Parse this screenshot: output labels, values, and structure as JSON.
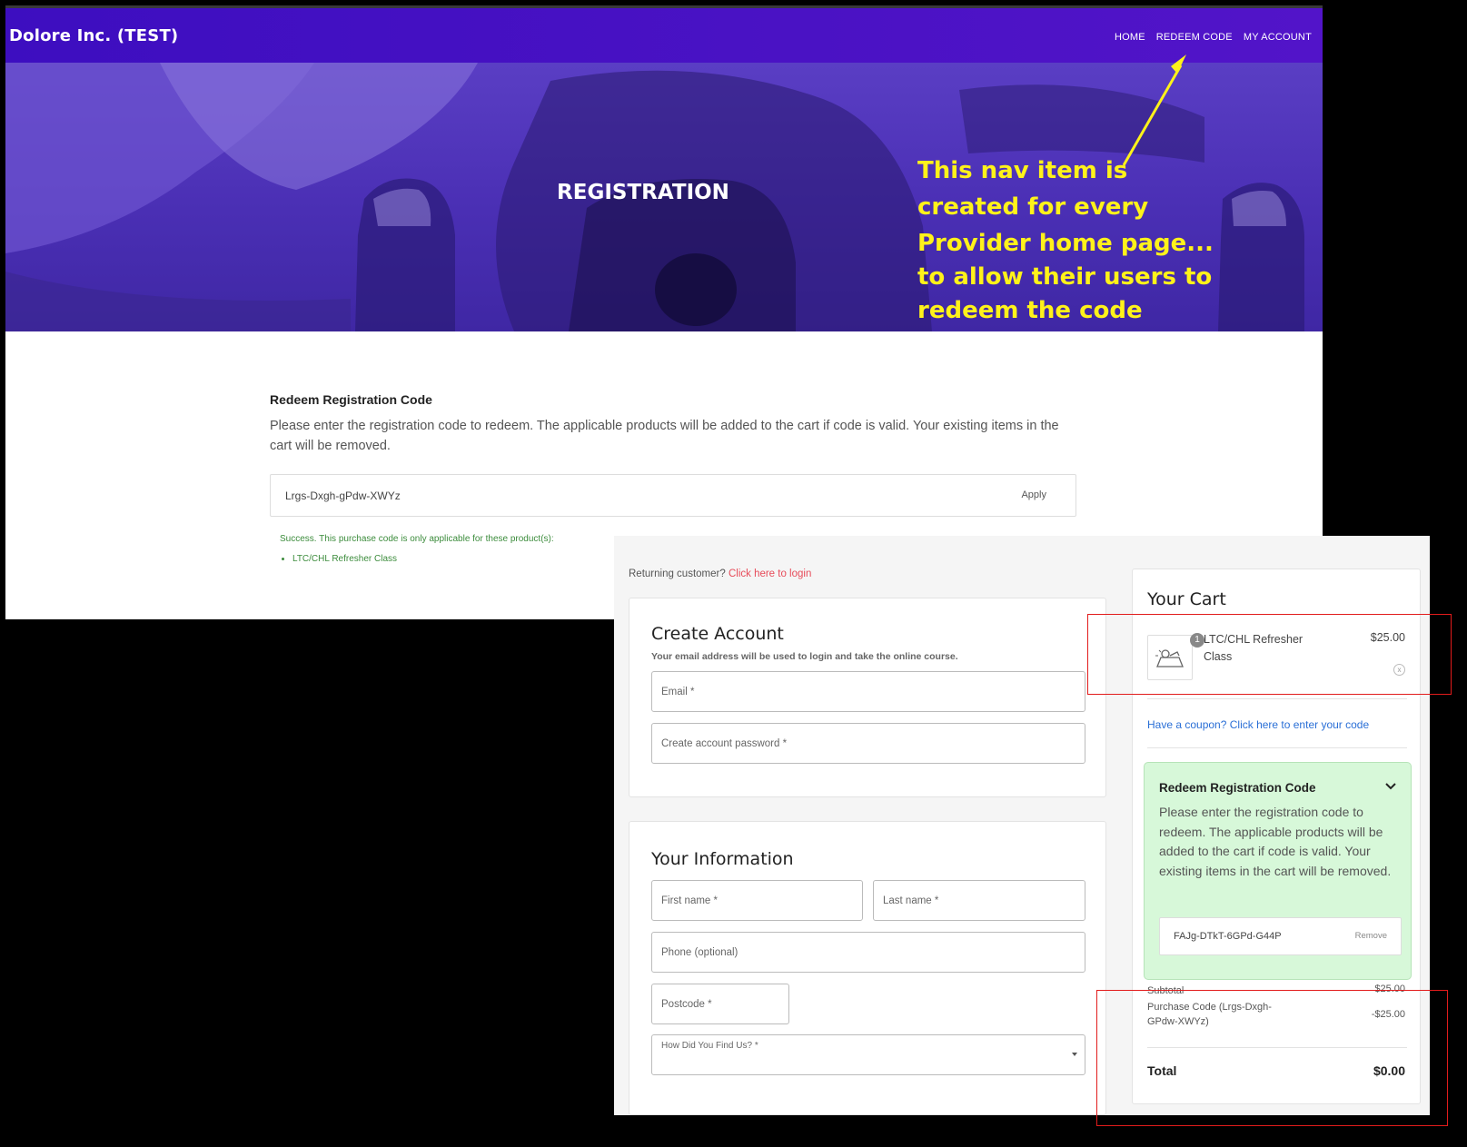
{
  "site": {
    "brand": "Dolore Inc. (TEST)",
    "nav": [
      "HOME",
      "REDEEM CODE",
      "MY ACCOUNT"
    ]
  },
  "hero": {
    "title": "REGISTRATION"
  },
  "redeem_page": {
    "heading": "Redeem Registration Code",
    "description": "Please enter the registration code to redeem. The applicable products will be added to the cart if code is valid. Your existing items in the cart will be removed.",
    "code_value": "Lrgs-Dxgh-gPdw-XWYz",
    "apply_label": "Apply",
    "success_message": "Success. This purchase code is only applicable for these product(s):",
    "success_products": [
      "LTC/CHL Refresher Class"
    ]
  },
  "annotation": {
    "lines": [
      "This nav item is",
      "created for every",
      "Provider home page...",
      "to allow their users to",
      "redeem the code"
    ],
    "color": "#fff21a"
  },
  "checkout": {
    "returning_text": "Returning customer?",
    "login_link": "Click here to login",
    "create_account": {
      "title": "Create Account",
      "subtitle": "Your email address will be used to login and take the online course.",
      "email_label": "Email *",
      "password_label": "Create account password *"
    },
    "your_information": {
      "title": "Your Information",
      "first_name_label": "First name *",
      "last_name_label": "Last name *",
      "phone_label": "Phone (optional)",
      "postcode_label": "Postcode *",
      "find_us_label": "How Did You Find Us? *"
    },
    "cart": {
      "title": "Your Cart",
      "item_qty": "1",
      "item_name": "LTC/CHL Refresher Class",
      "item_price": "$25.00",
      "remove_symbol": "x",
      "coupon_link": "Have a coupon? Click here to enter your code",
      "redeem": {
        "title": "Redeem Registration Code",
        "description": "Please enter the registration code to redeem. The applicable products will be added to the cart if code is valid. Your existing items in the cart will be removed.",
        "code_value": "FAJg-DTkT-6GPd-G44P",
        "remove_label": "Remove"
      },
      "subtotal_label": "Subtotal",
      "subtotal_value": "$25.00",
      "purchase_code_label": "Purchase Code (Lrgs-Dxgh-GPdw-XWYz)",
      "purchase_code_value": "-$25.00",
      "total_label": "Total",
      "total_value": "$0.00"
    }
  },
  "colors": {
    "nav_bg": "#4a12c4",
    "link_red": "#e74c5a",
    "link_blue": "#2a6fd6",
    "redeem_green": "#d7f8d9",
    "highlight_red": "#e21c1c"
  }
}
